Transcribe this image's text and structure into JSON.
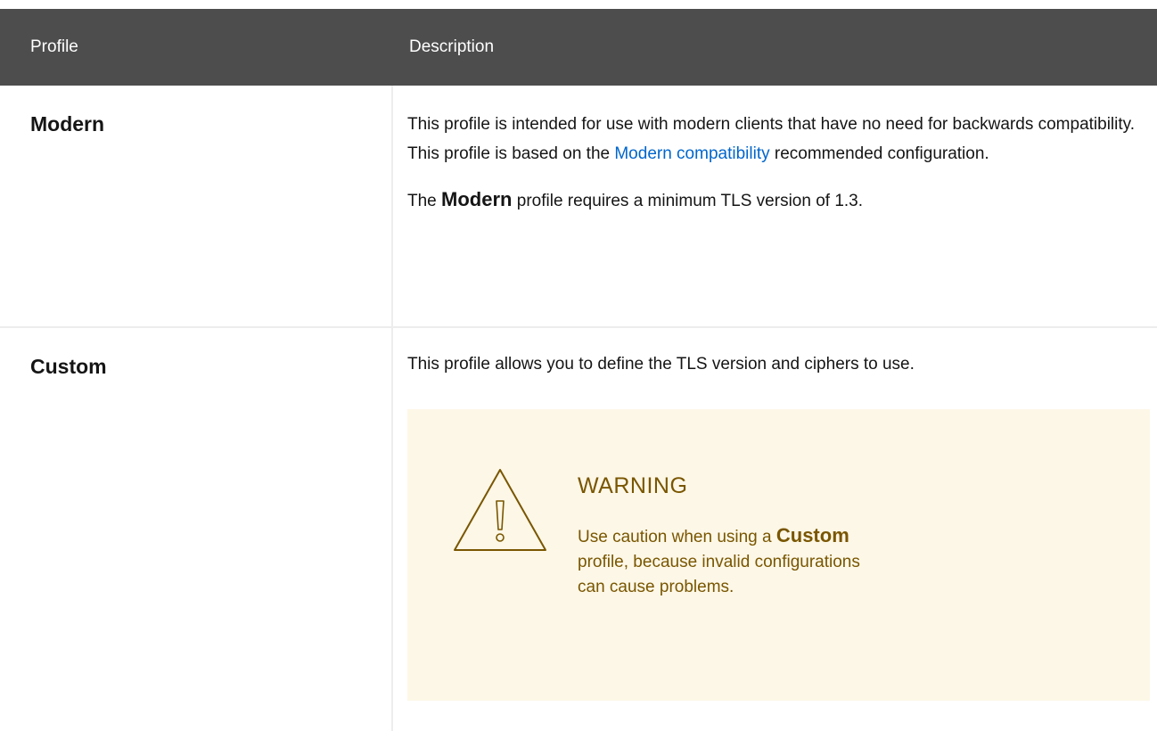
{
  "header": {
    "profile_label": "Profile",
    "description_label": "Description"
  },
  "rows": [
    {
      "name": "Modern",
      "desc_part1": "This profile is intended for use with modern clients that have no need for backwards compatibility. This profile is based on the ",
      "desc_link": "Modern compatibility",
      "desc_part2": " recommended configuration.",
      "note_pre": "The ",
      "note_keyword": "Modern",
      "note_post": " profile requires a minimum TLS version of 1.3."
    },
    {
      "name": "Custom",
      "desc": "This profile allows you to define the TLS version and ciphers to use.",
      "warning": {
        "title": "WARNING",
        "text_pre": "Use caution when using a ",
        "text_keyword": "Custom",
        "text_post": " profile, because invalid configurations can cause problems."
      }
    }
  ],
  "colors": {
    "header_bg": "#4d4d4d",
    "link": "#0066cc",
    "warning_bg": "#fdf7e7",
    "warning_fg": "#795600"
  }
}
